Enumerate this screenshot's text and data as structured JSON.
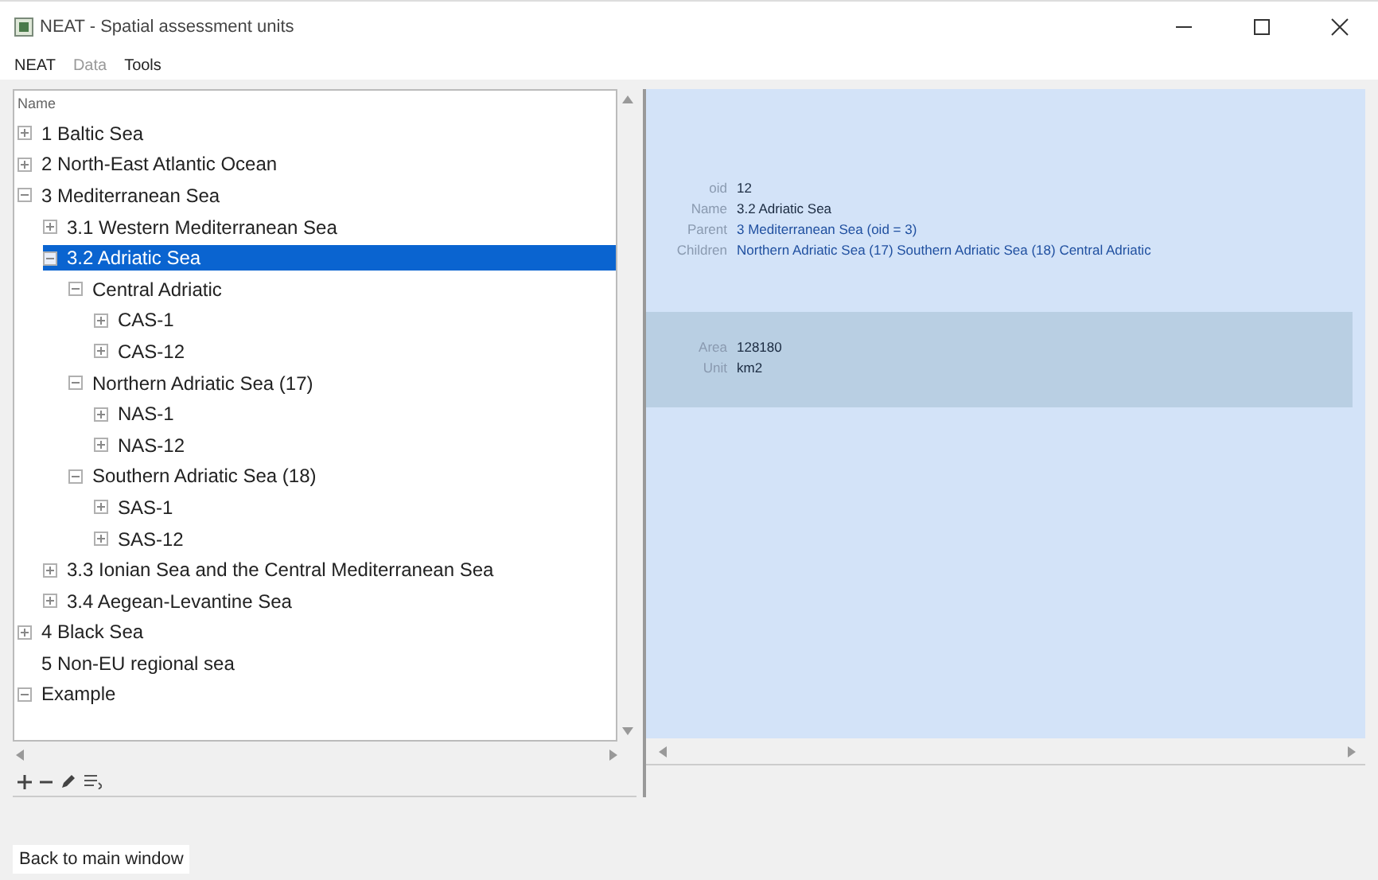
{
  "window": {
    "title": "NEAT - Spatial assessment units"
  },
  "menu": [
    {
      "label": "NEAT",
      "disabled": false
    },
    {
      "label": "Data",
      "disabled": true
    },
    {
      "label": "Tools",
      "disabled": false
    }
  ],
  "tree": {
    "column": "Name",
    "items": [
      {
        "label": "1 Baltic Sea",
        "expanded": false,
        "selected": false
      },
      {
        "label": "2 North-East Atlantic Ocean",
        "expanded": false,
        "selected": false
      },
      {
        "label": "3 Mediterranean Sea",
        "expanded": true,
        "selected": false,
        "children": [
          {
            "label": "3.1 Western Mediterranean Sea",
            "expanded": false,
            "selected": false
          },
          {
            "label": "3.2 Adriatic Sea",
            "expanded": true,
            "selected": true,
            "children": [
              {
                "label": "Central Adriatic",
                "expanded": true,
                "selected": false,
                "children": [
                  {
                    "label": "CAS-1",
                    "expanded": false,
                    "selected": false
                  },
                  {
                    "label": "CAS-12",
                    "expanded": false,
                    "selected": false
                  }
                ]
              },
              {
                "label": "Northern Adriatic Sea (17)",
                "expanded": true,
                "selected": false,
                "children": [
                  {
                    "label": "NAS-1",
                    "expanded": false,
                    "selected": false
                  },
                  {
                    "label": "NAS-12",
                    "expanded": false,
                    "selected": false
                  }
                ]
              },
              {
                "label": "Southern Adriatic Sea (18)",
                "expanded": true,
                "selected": false,
                "children": [
                  {
                    "label": "SAS-1",
                    "expanded": false,
                    "selected": false
                  },
                  {
                    "label": "SAS-12",
                    "expanded": false,
                    "selected": false
                  }
                ]
              }
            ]
          },
          {
            "label": "3.3 Ionian Sea and the Central Mediterranean Sea",
            "expanded": false,
            "selected": false
          },
          {
            "label": "3.4 Aegean-Levantine Sea",
            "expanded": false,
            "selected": false
          }
        ]
      },
      {
        "label": "4 Black Sea",
        "expanded": false,
        "selected": false
      },
      {
        "label": "5 Non-EU regional sea",
        "leaf": true,
        "selected": false
      },
      {
        "label": "Example",
        "expanded": true,
        "selected": false
      }
    ]
  },
  "details": [
    {
      "kind": "general",
      "fields": [
        {
          "label": "oid",
          "value": "12",
          "kind": "text"
        },
        {
          "label": "Name",
          "value": "3.2 Adriatic Sea",
          "kind": "text"
        },
        {
          "label": "Parent",
          "value": "3 Mediterranean Sea (oid = 3)",
          "kind": "link"
        },
        {
          "label": "Children",
          "value": "Northern Adriatic Sea (17) Southern Adriatic Sea (18) Central Adriatic",
          "kind": "link"
        }
      ]
    },
    {
      "kind": "measure",
      "fields": [
        {
          "label": "Area",
          "value": "128180",
          "kind": "text"
        },
        {
          "label": "Unit",
          "value": "km2",
          "kind": "text"
        }
      ]
    }
  ],
  "footer": {
    "button": "Back to main window"
  }
}
